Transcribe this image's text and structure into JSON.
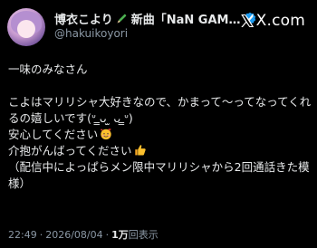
{
  "header": {
    "display_name": "博衣こより",
    "display_name_suffix": "新曲「NaN GAM…",
    "handle": "@hakuikoyori",
    "brand": "X.com"
  },
  "post": {
    "lines": [
      "一味のみなさん",
      "こよはマリリシャ大好きなので、かまって〜ってなってくれるの嬉しいです(ᐡ ̳ᴗ ̫ ᴗ ̳ᐡ)",
      "安心してください",
      "介抱がんばってください",
      "（配信中によっぱらメン限中マリリシャから2回通話きた模様）"
    ],
    "emoji": {
      "line3": "smiling-face-with-hearts",
      "line4": "thumbs-up"
    }
  },
  "meta": {
    "time": "22:49",
    "date": "2026/08/04",
    "views_count": "1万",
    "views_label": "回表示"
  },
  "colors": {
    "background": "#000000",
    "text": "#e7e9ea",
    "muted": "#8b98a5",
    "verified": "#1d9bf0"
  }
}
